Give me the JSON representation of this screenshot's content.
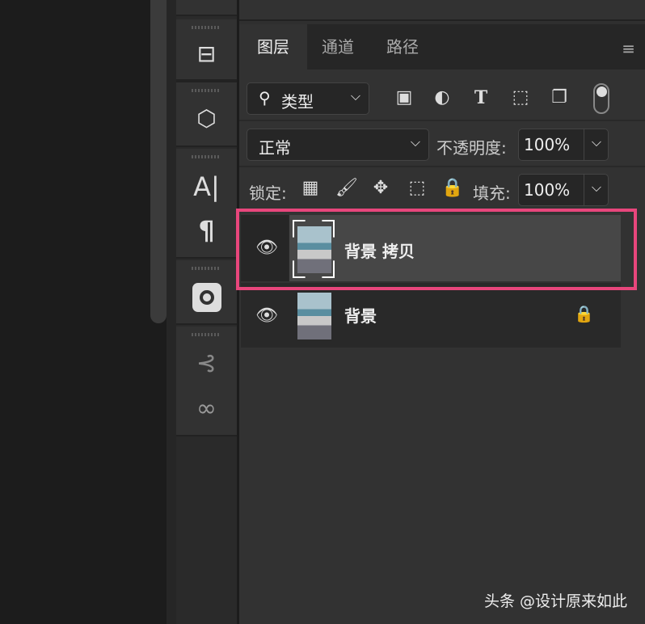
{
  "tabs": [
    {
      "label": "图层"
    },
    {
      "label": "通道"
    },
    {
      "label": "路径"
    }
  ],
  "filter": {
    "label": "类型",
    "icons": [
      "image-filter-icon",
      "adjustment-filter-icon",
      "type-filter-icon",
      "shape-filter-icon",
      "smart-object-filter-icon",
      "filter-toggle-icon"
    ]
  },
  "blend": {
    "mode": "正常",
    "opacity_label": "不透明度:",
    "opacity": "100%"
  },
  "lock": {
    "label": "锁定:",
    "fill_label": "填充:",
    "fill": "100%"
  },
  "layers": [
    {
      "name": "背景 拷贝",
      "selected": true,
      "visible": true,
      "locked": false
    },
    {
      "name": "背景",
      "selected": false,
      "visible": true,
      "locked": true
    }
  ],
  "tools": {
    "type_glyph": "A|",
    "para_glyph": "¶"
  },
  "watermark": "头条 @设计原来如此",
  "colors": {
    "highlight": "#e8467c"
  }
}
